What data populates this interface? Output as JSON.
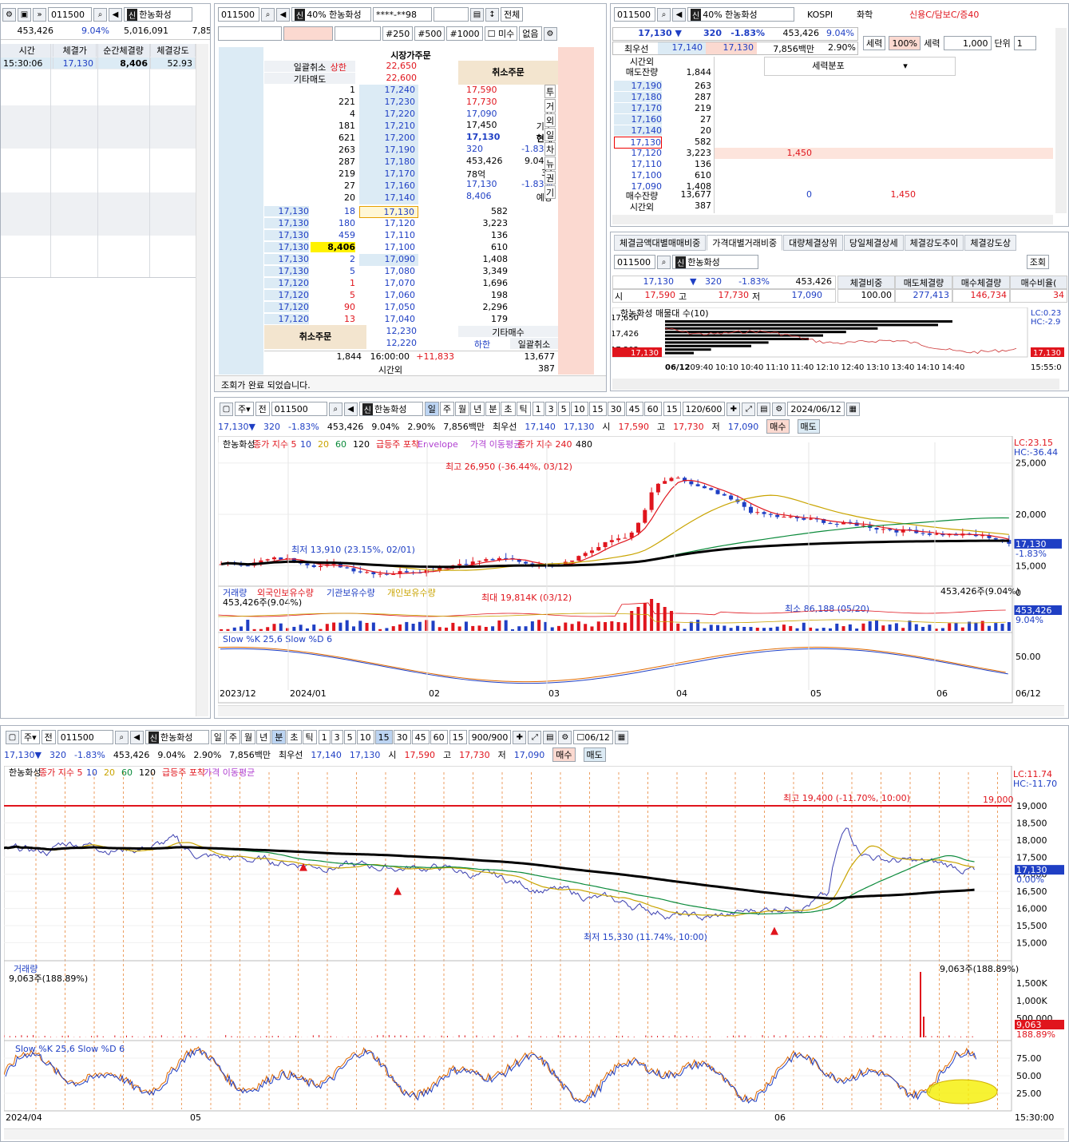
{
  "stock": {
    "code": "011500",
    "name": "한농화성",
    "market": "KOSPI",
    "sector": "화학",
    "margin": "신용C/담보C/증40",
    "margin_rate": "40%",
    "price": "17,130",
    "arrow": "▼",
    "change": "320",
    "change_pct": "-1.83%",
    "volume": "453,426",
    "vol_pct": "9.04%",
    "turnover": "2.90%",
    "amount": "7,856백만",
    "best_ask_label": "최우선",
    "best_ask": "17,140",
    "best_bid": "17,130",
    "open_label": "시",
    "open": "17,590",
    "high_label": "고",
    "high": "17,730",
    "low_label": "저",
    "low": "17,090",
    "buy_btn": "매수",
    "sell_btn": "매도"
  },
  "p1": {
    "sum": [
      "453,426",
      "9.04%",
      "5,016,091",
      "7,85"
    ],
    "headers": [
      "시간",
      "체결가",
      "순간체결량",
      "체결강도"
    ],
    "row": [
      "15:30:06",
      "17,130",
      "8,406",
      "52.93"
    ]
  },
  "p2": {
    "masked": "****-**98",
    "all_btn": "전체",
    "qty_labels": [
      "#250",
      "#500",
      "#1000"
    ],
    "mis": "미수",
    "none": "없음",
    "title": "시장가주문",
    "cancel": "일괄취소",
    "upper": "상한",
    "upper_price": "22,650",
    "etc_sell": "기타매도",
    "etc_sell_price": "22,600",
    "cancel_order": "취소주문",
    "asks": [
      [
        "1",
        "17,240"
      ],
      [
        "221",
        "17,230"
      ],
      [
        "4",
        "17,220"
      ],
      [
        "181",
        "17,210"
      ],
      [
        "621",
        "17,200"
      ],
      [
        "263",
        "17,190"
      ],
      [
        "287",
        "17,180"
      ],
      [
        "219",
        "17,170"
      ],
      [
        "27",
        "17,160"
      ],
      [
        "20",
        "17,140"
      ]
    ],
    "info": [
      [
        "17,590",
        "시"
      ],
      [
        "17,730",
        "고"
      ],
      [
        "17,090",
        "저"
      ],
      [
        "17,450",
        "기준"
      ],
      [
        "17,130",
        "현재"
      ],
      [
        "320",
        "-1.83%"
      ],
      [
        "453,426",
        "9.04%"
      ],
      [
        "78억",
        "37"
      ],
      [
        "17,130",
        "-1.83%"
      ],
      [
        "8,406",
        "예상"
      ]
    ],
    "side_tabs": [
      "투",
      "거",
      "외",
      "일",
      "차",
      "뉴",
      "권",
      "기"
    ],
    "bids": [
      [
        "17,130",
        "18",
        "17,130",
        "582"
      ],
      [
        "17,130",
        "180",
        "17,120",
        "3,223"
      ],
      [
        "17,130",
        "459",
        "17,110",
        "136"
      ],
      [
        "17,130",
        "8,406",
        "17,100",
        "610"
      ],
      [
        "17,130",
        "2",
        "17,090",
        "1,408"
      ],
      [
        "17,130",
        "5",
        "17,080",
        "3,349"
      ],
      [
        "17,120",
        "1",
        "17,070",
        "1,696"
      ],
      [
        "17,120",
        "5",
        "17,060",
        "198"
      ],
      [
        "17,120",
        "90",
        "17,050",
        "2,296"
      ],
      [
        "17,120",
        "13",
        "17,040",
        "179"
      ]
    ],
    "low_prices": [
      "12,230",
      "12,220"
    ],
    "etc_buy": "기타매수",
    "lower": "하한",
    "cancel2": "일괄취소",
    "cancel_order2": "취소주문",
    "total": [
      "1,844",
      "16:00:00",
      "+11,833",
      "13,677"
    ],
    "after_label": "시간외",
    "after": "387",
    "status": "조회가 완료 되었습니다."
  },
  "p3": {
    "force": "세력",
    "force_val": "100%",
    "force2": "세력",
    "qty": "1,000",
    "unit": "단위",
    "unit_val": "1",
    "after_label": "시간외",
    "sell_rem": "매도잔량",
    "sell_rem_val": "1,844",
    "dist": "세력분포",
    "asks": [
      [
        "17,190",
        "263"
      ],
      [
        "17,180",
        "287"
      ],
      [
        "17,170",
        "219"
      ],
      [
        "17,160",
        "27"
      ],
      [
        "17,140",
        "20"
      ]
    ],
    "bids": [
      [
        "17,130",
        "582",
        ""
      ],
      [
        "17,120",
        "3,223",
        "1,450"
      ],
      [
        "17,110",
        "136",
        ""
      ],
      [
        "17,100",
        "610",
        ""
      ],
      [
        "17,090",
        "1,408",
        ""
      ]
    ],
    "buy_rem": "매수잔량",
    "buy_rem_val": "13,677",
    "buy_rem_f": "0",
    "buy_rem_f2": "1,450",
    "after_val": "387"
  },
  "p4": {
    "tabs": [
      "체결금액대별매매비중",
      "가격대별거래비중",
      "대량체결상위",
      "당일체결상세",
      "체결강도추이",
      "체결강도상"
    ],
    "query": "조회",
    "hdr": [
      "체결비중",
      "매도체결량",
      "매수체결량",
      "매수비율("
    ],
    "vals": [
      "100.00",
      "277,413",
      "146,734",
      "34"
    ],
    "chart_title": "한농화성 매물대 수(10)",
    "yticks": [
      "17,650",
      "17,426",
      "17,202"
    ],
    "cur": "17,130",
    "times": [
      "06/12",
      "09:40",
      "10:10",
      "10:40",
      "11:10",
      "11:40",
      "12:10",
      "12:40",
      "13:10",
      "13:40",
      "14:10",
      "14:40"
    ],
    "right_time": "15:55:0",
    "lc": "LC:0.23",
    "hc": "HC:-2.9",
    "bars": [
      1.0,
      0.95,
      0.74,
      0.63,
      0.55,
      0.5,
      0.36,
      0.3,
      0.16,
      0.1
    ]
  },
  "daily": {
    "periods": [
      "일",
      "주",
      "월",
      "년",
      "분",
      "초",
      "틱"
    ],
    "nums": [
      "1",
      "3",
      "5",
      "10",
      "15",
      "30",
      "45",
      "60"
    ],
    "sel": "15",
    "count": "120/600",
    "date": "2024/06/12",
    "legend": [
      "한농화성",
      "종가 지수 5",
      "10",
      "20",
      "60",
      "120",
      "급등주 포착",
      "Envelope",
      "가격 이동평균",
      "종가 지수 240",
      "480"
    ],
    "high_lbl": "최고 26,950 (-36.44%, 03/12)",
    "low_lbl": "최저 13,910 (23.15%, 02/01)",
    "lc": "LC:23.15",
    "hc": "HC:-36.44",
    "yticks": [
      "25,000",
      "20,000",
      "15,000"
    ],
    "cur_lbl": "17,130",
    "cur_pct": "-1.83%",
    "vol_legend": [
      "거래량",
      "외국인보유수량",
      "기관보유수량",
      "개인보유수량"
    ],
    "vol_val": "453,426주(9.04%)",
    "vol_max": "최대 19,814K (03/12)",
    "vol_min": "최소 86,188 (05/20)",
    "vol_right": "453,426주(9.04%)",
    "vol_cur": "453,426",
    "vol_cur_pct": "9.04%",
    "vol_zero": "0",
    "sto": "Slow %K 25,6  Slow %D 6",
    "sto_tick": "50.00",
    "xticks": [
      "2023/12",
      "2024/01",
      "02",
      "03",
      "04",
      "05",
      "06",
      "06/12"
    ]
  },
  "minute": {
    "periods": [
      "일",
      "주",
      "월",
      "년",
      "분",
      "초",
      "틱"
    ],
    "nums": [
      "1",
      "3",
      "5",
      "10",
      "15",
      "30",
      "45",
      "60"
    ],
    "sel": "15",
    "count": "900/900",
    "date": "06/12",
    "legend": [
      "한농화성",
      "종가 지수 5",
      "10",
      "20",
      "60",
      "120",
      "급등주 포착",
      "가격 이동평균"
    ],
    "high_lbl": "최고 19,400 (-11.70%, 10:00)",
    "low_lbl": "최저 15,330 (11.74%, 10:00)",
    "line_lbl": "19,000",
    "lc": "LC:11.74",
    "hc": "HC:-11.70",
    "yticks": [
      "19,000",
      "18,500",
      "18,000",
      "17,500",
      "17,000",
      "16,500",
      "16,000",
      "15,500",
      "15,000"
    ],
    "cur_lbl": "17,130",
    "cur_pct": "0.00%",
    "vol_label": "거래량",
    "vol_val": "9,063주(188.89%)",
    "vol_right": "9,063주(188.89%)",
    "vol_ticks": [
      "1,500K",
      "1,000K",
      "500,000"
    ],
    "vol_cur": "9,063",
    "vol_cur_pct": "188.89%",
    "sto": "Slow %K 25,6  Slow %D 6",
    "sto_ticks": [
      "75.00",
      "50.00",
      "25.00"
    ],
    "xticks": [
      "2024/04",
      "05",
      "06",
      "15:30:00"
    ]
  },
  "chart_data": [
    {
      "type": "line",
      "title": "한농화성 일봉",
      "ylim": [
        13000,
        27000
      ],
      "points": [
        {
          "label": "최고",
          "value": 26950,
          "date": "03/12"
        },
        {
          "label": "최저",
          "value": 13910,
          "date": "02/01"
        },
        {
          "label": "현재",
          "value": 17130,
          "date": "06/12"
        }
      ]
    },
    {
      "type": "line",
      "title": "한농화성 15분봉",
      "ylim": [
        14800,
        19700
      ],
      "points": [
        {
          "label": "최고",
          "value": 19400
        },
        {
          "label": "최저",
          "value": 15330
        },
        {
          "label": "현재",
          "value": 17130
        }
      ]
    }
  ],
  "colors": {
    "up": "#e0151d",
    "down": "#1f3fc4",
    "accent": "#f7d9cf",
    "bid_bg": "#dcebf5"
  }
}
